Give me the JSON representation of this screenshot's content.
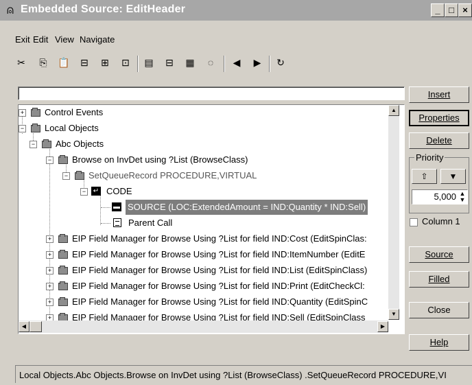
{
  "window": {
    "title": "Embedded Source: EditHeader",
    "minimize": "_",
    "maximize": "□",
    "close": "×"
  },
  "menu": {
    "items": [
      "Exit",
      "Edit",
      "View",
      "Navigate"
    ]
  },
  "toolbar": {
    "icons": [
      "cut-icon",
      "copy-icon",
      "paste-icon",
      "insert-before-icon",
      "insert-after-icon",
      "insert-child-icon",
      "embed-icon",
      "collapse-icon",
      "expand-icon",
      "find-icon",
      "previous-icon",
      "next-icon",
      "refresh-icon"
    ]
  },
  "search": {
    "value": ""
  },
  "tree": {
    "rows": [
      {
        "label": "Control Events"
      },
      {
        "label": "Local Objects"
      },
      {
        "label": "Abc Objects"
      },
      {
        "label": "Browse on InvDet using ?List (BrowseClass)"
      },
      {
        "label": "SetQueueRecord PROCEDURE,VIRTUAL"
      },
      {
        "label": "CODE"
      },
      {
        "label": "SOURCE (LOC:ExtendedAmount = IND:Quantity * IND:Sell)"
      },
      {
        "label": "Parent Call"
      },
      {
        "label": "EIP Field Manager for Browse Using ?List for field IND:Cost (EditSpinClas:"
      },
      {
        "label": "EIP Field Manager for Browse Using ?List for field IND:ItemNumber (EditE"
      },
      {
        "label": "EIP Field Manager for Browse Using ?List for field IND:List (EditSpinClass)"
      },
      {
        "label": "EIP Field Manager for Browse Using ?List for field IND:Print (EditCheckCl:"
      },
      {
        "label": "EIP Field Manager for Browse Using ?List for field IND:Quantity (EditSpinC"
      },
      {
        "label": "EIP Field Manager for Browse Using ?List for field IND:Sell (EditSpinClass"
      }
    ]
  },
  "buttons": {
    "insert": "Insert",
    "properties": "Properties",
    "delete": "Delete",
    "source": "Source",
    "filled": "Filled",
    "close": "Close",
    "help": "Help"
  },
  "priority": {
    "label": "Priority",
    "value": "5,000"
  },
  "column1": {
    "label": "Column 1",
    "checked": false
  },
  "status": {
    "text": "Local Objects.Abc Objects.Browse on InvDet using ?List (BrowseClass) .SetQueueRecord PROCEDURE,VI"
  }
}
